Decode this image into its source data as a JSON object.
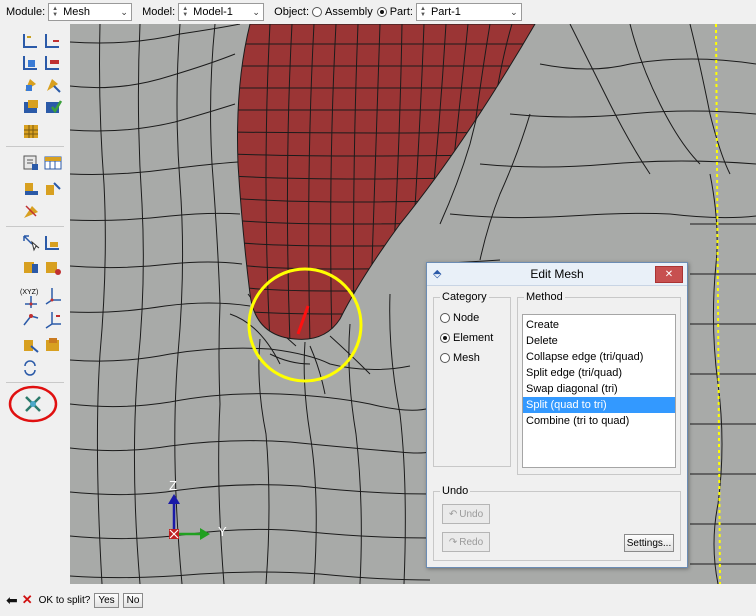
{
  "context_bar": {
    "module_label": "Module:",
    "module_value": "Mesh",
    "model_label": "Model:",
    "model_value": "Model-1",
    "object_label": "Object:",
    "assembly_label": "Assembly",
    "part_label": "Part:",
    "part_value": "Part-1"
  },
  "viewport": {
    "axis_z": "Z",
    "axis_y": "Y"
  },
  "toolbox": {
    "xyz_label": "(XYZ)"
  },
  "dialog": {
    "title": "Edit Mesh",
    "category_label": "Category",
    "categories": [
      "Node",
      "Element",
      "Mesh"
    ],
    "selected_category": "Element",
    "method_label": "Method",
    "methods": [
      "Create",
      "Delete",
      "Collapse edge (tri/quad)",
      "Split edge (tri/quad)",
      "Swap diagonal (tri)",
      "Split (quad to tri)",
      "Combine (tri to quad)"
    ],
    "selected_method": "Split (quad to tri)",
    "undo_group_label": "Undo",
    "undo_button": "Undo",
    "redo_button": "Redo",
    "settings_button": "Settings..."
  },
  "prompt": {
    "text": "OK to split?",
    "yes": "Yes",
    "no": "No"
  },
  "colors": {
    "mesh_background": "#a8aaa8",
    "part_region": "#9b3535",
    "highlight_circle": "#ffff00",
    "toolbox_circle": "#e01010",
    "selection": "#3399ff"
  }
}
